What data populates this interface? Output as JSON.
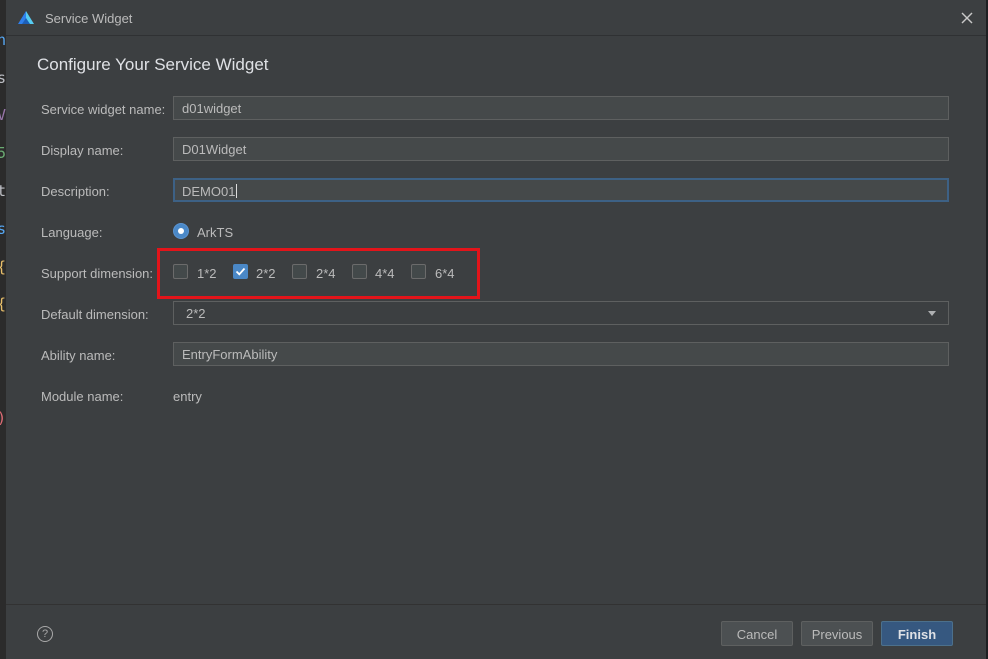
{
  "window": {
    "title": "Service Widget"
  },
  "page": {
    "heading": "Configure Your Service Widget"
  },
  "form": {
    "service_widget_name": {
      "label": "Service widget name:",
      "value": "d01widget"
    },
    "display_name": {
      "label": "Display name:",
      "value": "D01Widget"
    },
    "description": {
      "label": "Description:",
      "value": "DEMO01"
    },
    "language": {
      "label": "Language:",
      "selected": "ArkTS"
    },
    "support_dimension": {
      "label": "Support dimension:",
      "options": [
        {
          "label": "1*2",
          "checked": false
        },
        {
          "label": "2*2",
          "checked": true
        },
        {
          "label": "2*4",
          "checked": false
        },
        {
          "label": "4*4",
          "checked": false
        },
        {
          "label": "6*4",
          "checked": false
        }
      ]
    },
    "default_dimension": {
      "label": "Default dimension:",
      "value": "2*2"
    },
    "ability_name": {
      "label": "Ability name:",
      "value": "EntryFormAbility"
    },
    "module_name": {
      "label": "Module name:",
      "value": "entry"
    }
  },
  "footer": {
    "help_label": "?",
    "cancel_label": "Cancel",
    "previous_label": "Previous",
    "finish_label": "Finish"
  },
  "background_editor": {
    "glyphs": [
      "n",
      "s",
      "V",
      "5",
      "t",
      "s",
      "{",
      "{",
      ")"
    ],
    "glyph_colors": [
      "#56a8f5",
      "#bcbec4",
      "#9876aa",
      "#6aab73",
      "#bcbec4",
      "#56a8f5",
      "#e8bf6a",
      "#e8bf6a",
      "#e06c75"
    ]
  },
  "colors": {
    "accent": "#4a88c7",
    "primary_button": "#365880",
    "highlight_box": "#e3141a",
    "dialog_bg": "#3c3f41"
  },
  "icons": {
    "app_logo": "deveco-logo-icon",
    "close": "close-icon",
    "help": "help-icon",
    "dropdown": "chevron-down-icon",
    "check": "check-icon"
  }
}
